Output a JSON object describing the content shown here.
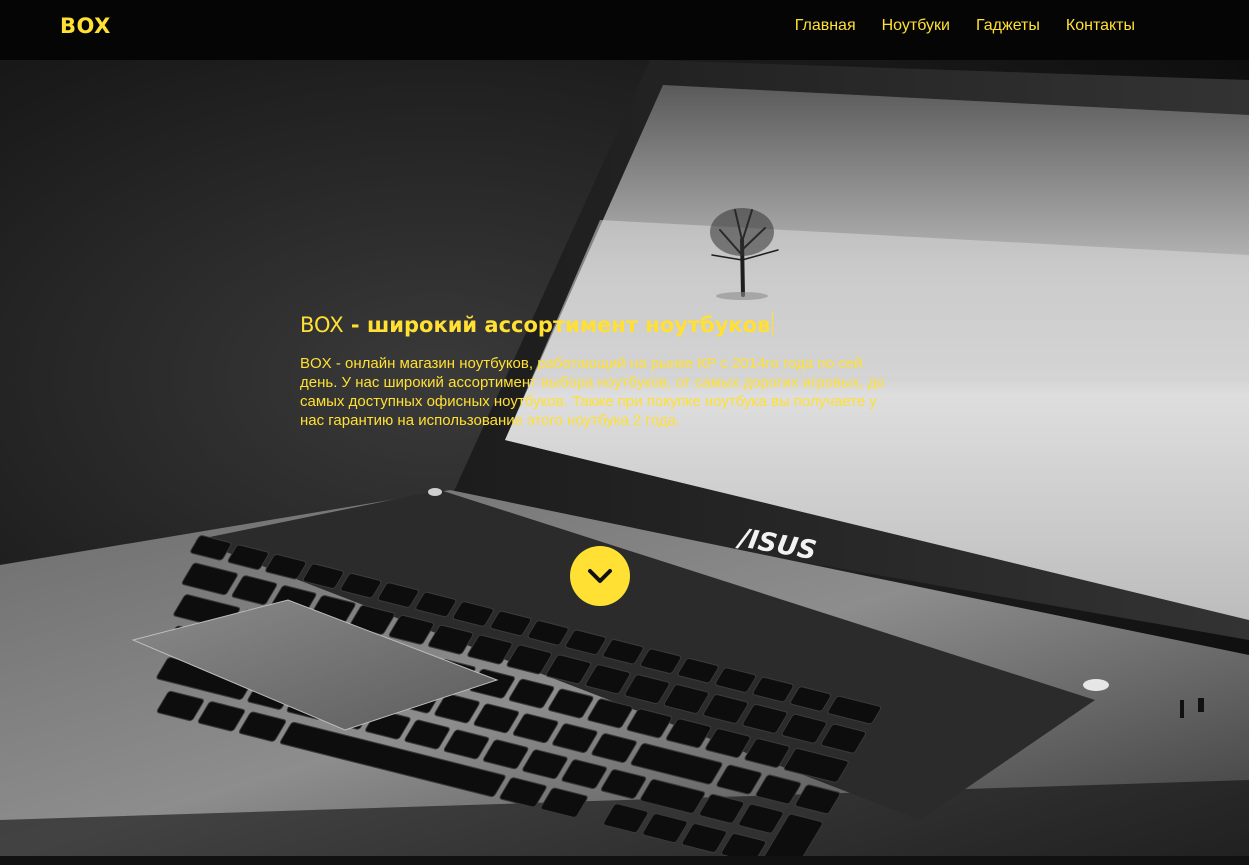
{
  "colors": {
    "accent": "#ffe033",
    "navbar_bg": "#050505",
    "hero_text": "#ffe033"
  },
  "header": {
    "brand": "BOX",
    "nav": [
      {
        "label": "Главная"
      },
      {
        "label": "Ноутбуки"
      },
      {
        "label": "Гаджеты"
      },
      {
        "label": "Контакты"
      }
    ]
  },
  "hero": {
    "title_brand": "BOX",
    "title_rest": " - широкий ассортимент ноутбуков",
    "description": "BOX - онлайн магазин ноутбуков, работающий на рынке КР с 2014го года по сей день. У нас широкий ассортимент выбора ноутбуков, от самых дорогих игровых, до самых доступных офисных ноутбуков. Также при покупке ноутбука вы получаете у нас гарантию на использование этого ноутбука 2 года.",
    "laptop_logo": "/ISUS",
    "scroll_icon": "chevron-down-icon"
  }
}
